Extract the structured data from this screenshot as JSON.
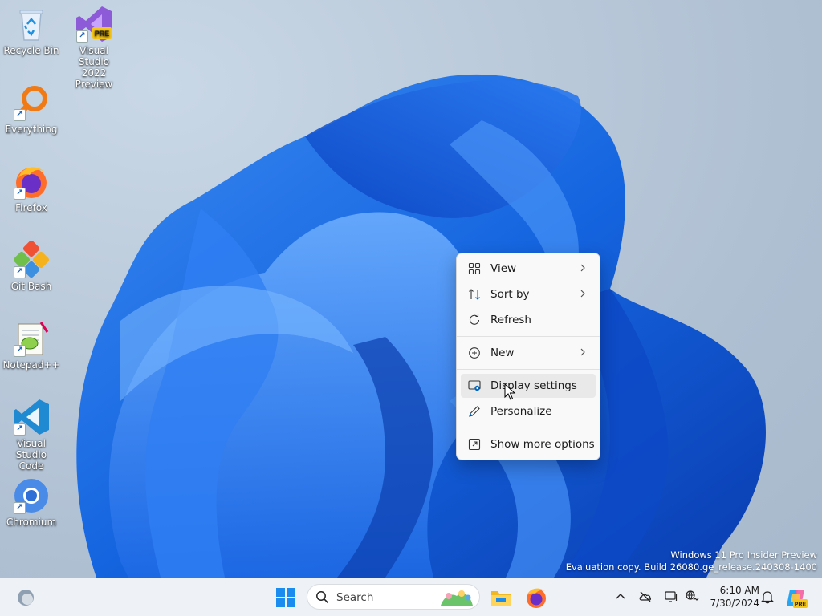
{
  "desktop": {
    "icons": [
      {
        "label": "Recycle Bin",
        "icon": "recycle-bin-icon"
      },
      {
        "label": "Visual Studio 2022 Preview",
        "line1": "Visual Studio",
        "line2": "2022 Preview",
        "badge": "PRE",
        "icon": "visual-studio-icon"
      },
      {
        "label": "Everything",
        "icon": "everything-search-icon"
      },
      {
        "label": "Firefox",
        "icon": "firefox-icon"
      },
      {
        "label": "Git Bash",
        "icon": "git-bash-icon"
      },
      {
        "label": "Notepad++",
        "icon": "notepad-plus-plus-icon"
      },
      {
        "label": "Visual Studio Code",
        "line1": "Visual Studio",
        "line2": "Code",
        "icon": "vscode-icon"
      },
      {
        "label": "Chromium",
        "icon": "chromium-icon"
      }
    ],
    "shortcut_arrow": "↗"
  },
  "context_menu": {
    "items": [
      {
        "label": "View",
        "icon": "grid-view-icon",
        "submenu": true
      },
      {
        "label": "Sort by",
        "icon": "sort-arrows-icon",
        "submenu": true
      },
      {
        "label": "Refresh",
        "icon": "refresh-icon",
        "submenu": false
      },
      {
        "label": "New",
        "icon": "plus-circle-icon",
        "submenu": true
      },
      {
        "label": "Display settings",
        "icon": "display-settings-icon",
        "submenu": false,
        "hovered": true
      },
      {
        "label": "Personalize",
        "icon": "pen-icon",
        "submenu": false
      },
      {
        "label": "Show more options",
        "icon": "share-window-icon",
        "submenu": false
      }
    ]
  },
  "watermark": {
    "line1": "Windows 11 Pro Insider Preview",
    "line2": "Evaluation copy. Build 26080.ge_release.240308-1400"
  },
  "taskbar": {
    "search_placeholder": "Search",
    "clock_time": "6:10 AM",
    "clock_date": "7/30/2024",
    "copilot_badge": "PRE"
  },
  "colors": {
    "accent": "#0067c0",
    "taskbar_bg": "#eef1f5",
    "menu_bg": "#f9f9f9",
    "menu_hover": "#e9e9e9"
  }
}
